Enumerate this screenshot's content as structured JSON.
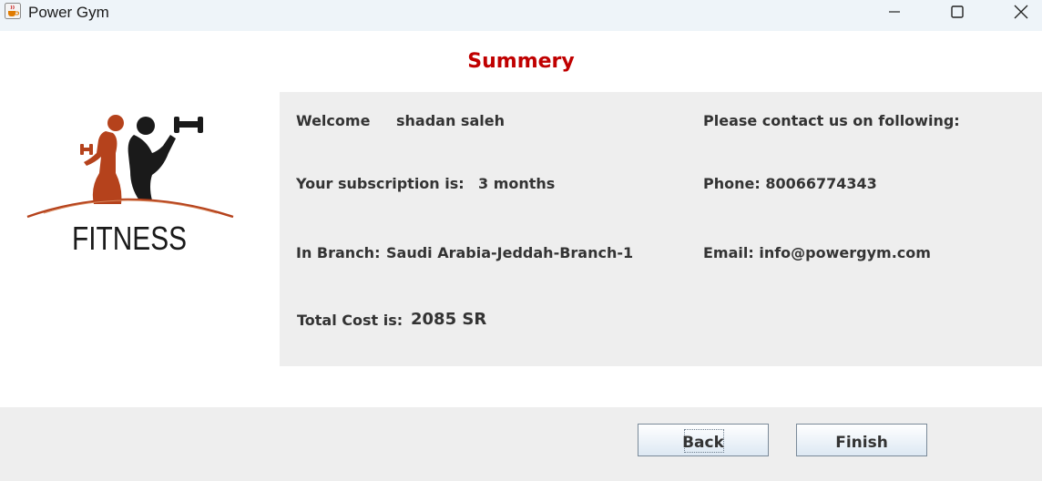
{
  "window": {
    "title": "Power Gym",
    "icon": "java-coffee-cup-icon"
  },
  "heading": "Summery",
  "logo": {
    "text": "FITNESS"
  },
  "summary": {
    "welcome_label": "Welcome",
    "user_name": "shadan saleh",
    "subscription_label": "Your subscription is:",
    "subscription_value": "3 months",
    "branch_label": "In Branch:",
    "branch_value": "Saudi Arabia-Jeddah-Branch-1",
    "total_label": "Total Cost is:",
    "total_value": "2085 SR"
  },
  "contact": {
    "header": "Please contact us on following:",
    "phone": "Phone: 80066774343",
    "email": "Email: info@powergym.com"
  },
  "buttons": {
    "back": "Back",
    "finish": "Finish"
  },
  "colors": {
    "heading": "#c00000",
    "logo_female": "#b5421c",
    "logo_male": "#1a1a1a",
    "panel": "#eeeeee"
  }
}
